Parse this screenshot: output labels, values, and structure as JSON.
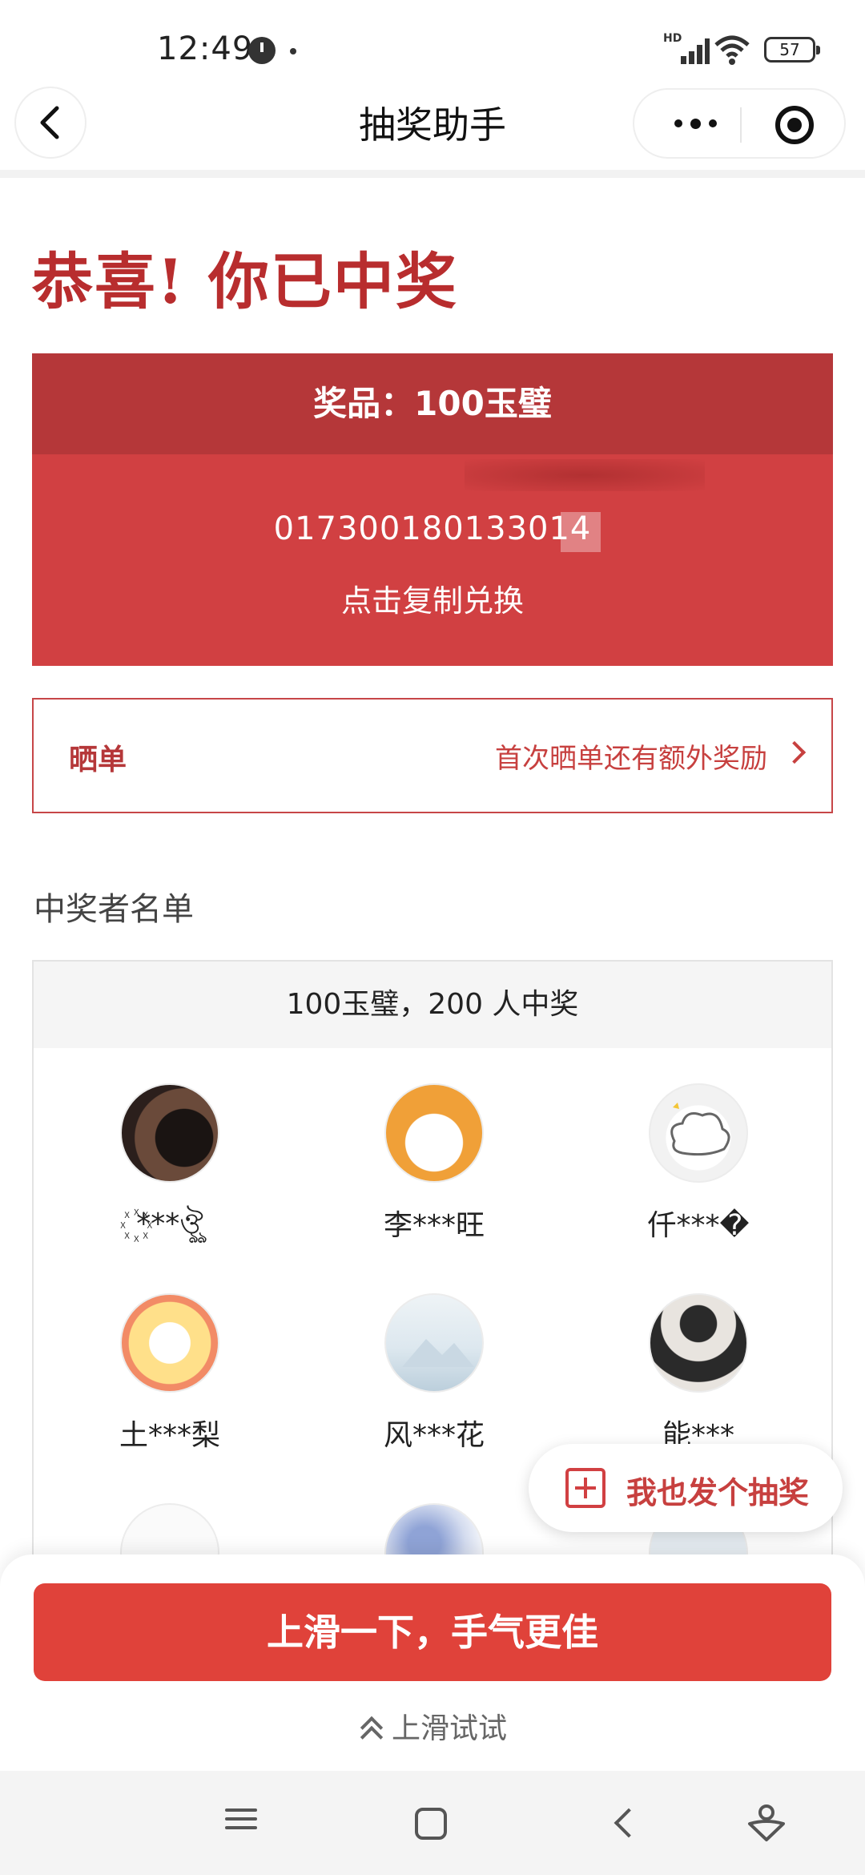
{
  "status_bar": {
    "time": "12:49",
    "network_badge": "HD",
    "battery": "57"
  },
  "nav": {
    "title": "抽奖助手"
  },
  "congrats": {
    "title": "恭喜! 你已中奖"
  },
  "prize": {
    "label": "奖品：100玉璧",
    "code": "017300180133014",
    "copy_hint": "点击复制兑换"
  },
  "show_order": {
    "label": "晒单",
    "tip": "首次晒单还有额外奖励"
  },
  "winners": {
    "section_title": "中奖者名单",
    "summary": "100玉璧，200 人中奖",
    "items": [
      {
        "name": "꙰***ঔৣ",
        "avatar_colors": [
          "#2b1f1c",
          "#6a4a3a"
        ]
      },
      {
        "name": "李***旺",
        "avatar_colors": [
          "#f0a038",
          "#ffffff"
        ]
      },
      {
        "name": "仟***�",
        "avatar_colors": [
          "#ffffff",
          "#f2f2f2"
        ]
      },
      {
        "name": "土***梨",
        "avatar_colors": [
          "#ffe08a",
          "#f28b66"
        ]
      },
      {
        "name": "风***花",
        "avatar_colors": [
          "#dde8ef",
          "#bccfdc"
        ]
      },
      {
        "name": "能***",
        "avatar_colors": [
          "#e8e4df",
          "#2a2a2a"
        ]
      }
    ]
  },
  "fab": {
    "label": "我也发个抽奖"
  },
  "bottom_sheet": {
    "cta": "上滑一下，手气更佳",
    "hint": "上滑试试"
  },
  "colors": {
    "brand_red": "#d14042",
    "header_red": "#b53739",
    "cta_red": "#e0423a",
    "title_red": "#b82d2e"
  }
}
